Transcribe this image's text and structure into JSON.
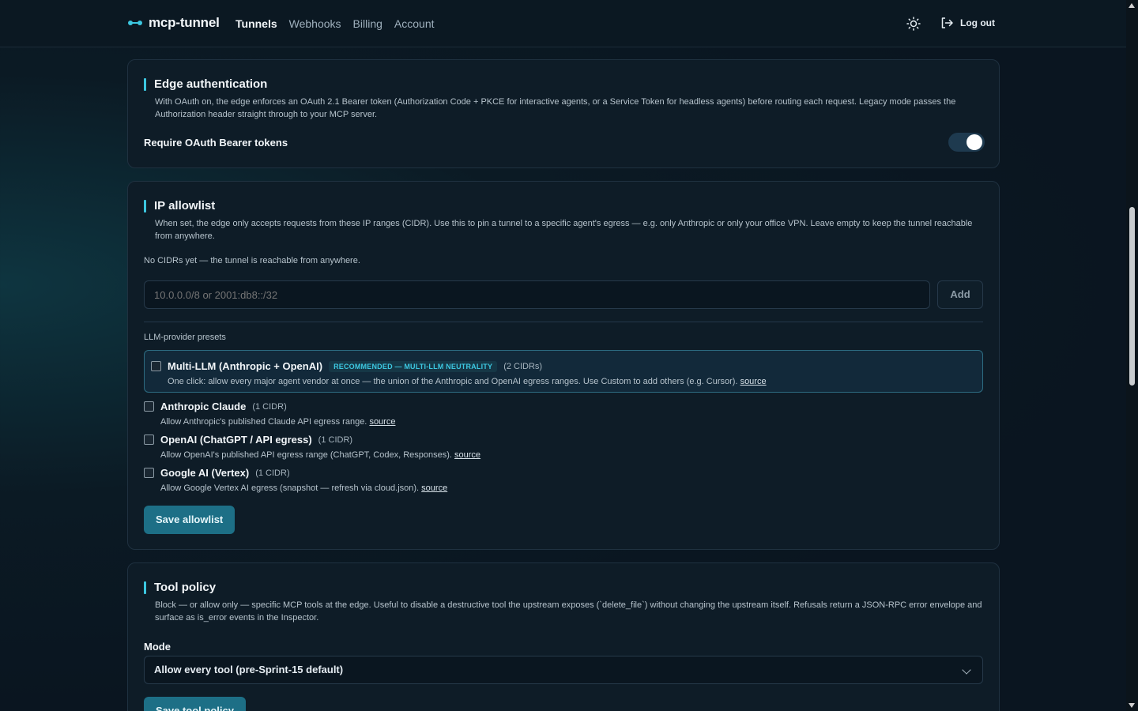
{
  "app": {
    "brand": "mcp-tunnel",
    "nav": [
      {
        "label": "Tunnels",
        "active": true
      },
      {
        "label": "Webhooks",
        "active": false
      },
      {
        "label": "Billing",
        "active": false
      },
      {
        "label": "Account",
        "active": false
      }
    ],
    "theme_icon": "sun-icon",
    "logout_label": "Log out",
    "logout_icon": "logout-icon",
    "accent": "#3cc7e0"
  },
  "edge_auth": {
    "title": "Edge authentication",
    "description": "With OAuth on, the edge enforces an OAuth 2.1 Bearer token (Authorization Code + PKCE for interactive agents, or a Service Token for headless agents) before routing each request. Legacy mode passes the Authorization header straight through to your MCP server.",
    "toggle_label": "Require OAuth Bearer tokens",
    "toggle_on": true
  },
  "ip_allowlist": {
    "title": "IP allowlist",
    "description": "When set, the edge only accepts requests from these IP ranges (CIDR). Use this to pin a tunnel to a specific agent's egress — e.g. only Anthropic or only your office VPN. Leave empty to keep the tunnel reachable from anywhere.",
    "empty_state": "No CIDRs yet — the tunnel is reachable from anywhere.",
    "input_placeholder": "10.0.0.0/8 or 2001:db8::/32",
    "add_label": "Add",
    "presets_heading": "LLM-provider presets",
    "presets": [
      {
        "name": "Multi-LLM (Anthropic + OpenAI)",
        "badge": "RECOMMENDED — MULTI-LLM NEUTRALITY",
        "count": "(2 CIDRs)",
        "desc": "One click: allow every major agent vendor at once — the union of the Anthropic and OpenAI egress ranges. Use Custom to add others (e.g. Cursor).",
        "source": "source",
        "checked": false
      },
      {
        "name": "Anthropic Claude",
        "count": "(1 CIDR)",
        "desc": "Allow Anthropic's published Claude API egress range.",
        "source": "source",
        "checked": false
      },
      {
        "name": "OpenAI (ChatGPT / API egress)",
        "count": "(1 CIDR)",
        "desc": "Allow OpenAI's published API egress range (ChatGPT, Codex, Responses).",
        "source": "source",
        "checked": false
      },
      {
        "name": "Google AI (Vertex)",
        "count": "(1 CIDR)",
        "desc": "Allow Google Vertex AI egress (snapshot — refresh via cloud.json).",
        "source": "source",
        "checked": false
      }
    ],
    "save_label": "Save allowlist"
  },
  "tool_policy": {
    "title": "Tool policy",
    "description": "Block — or allow only — specific MCP tools at the edge. Useful to disable a destructive tool the upstream exposes (`delete_file`) without changing the upstream itself. Refusals return a JSON-RPC error envelope and surface as is_error events in the Inspector.",
    "mode_label": "Mode",
    "mode_value": "Allow every tool (pre-Sprint-15 default)",
    "save_label": "Save tool policy"
  }
}
